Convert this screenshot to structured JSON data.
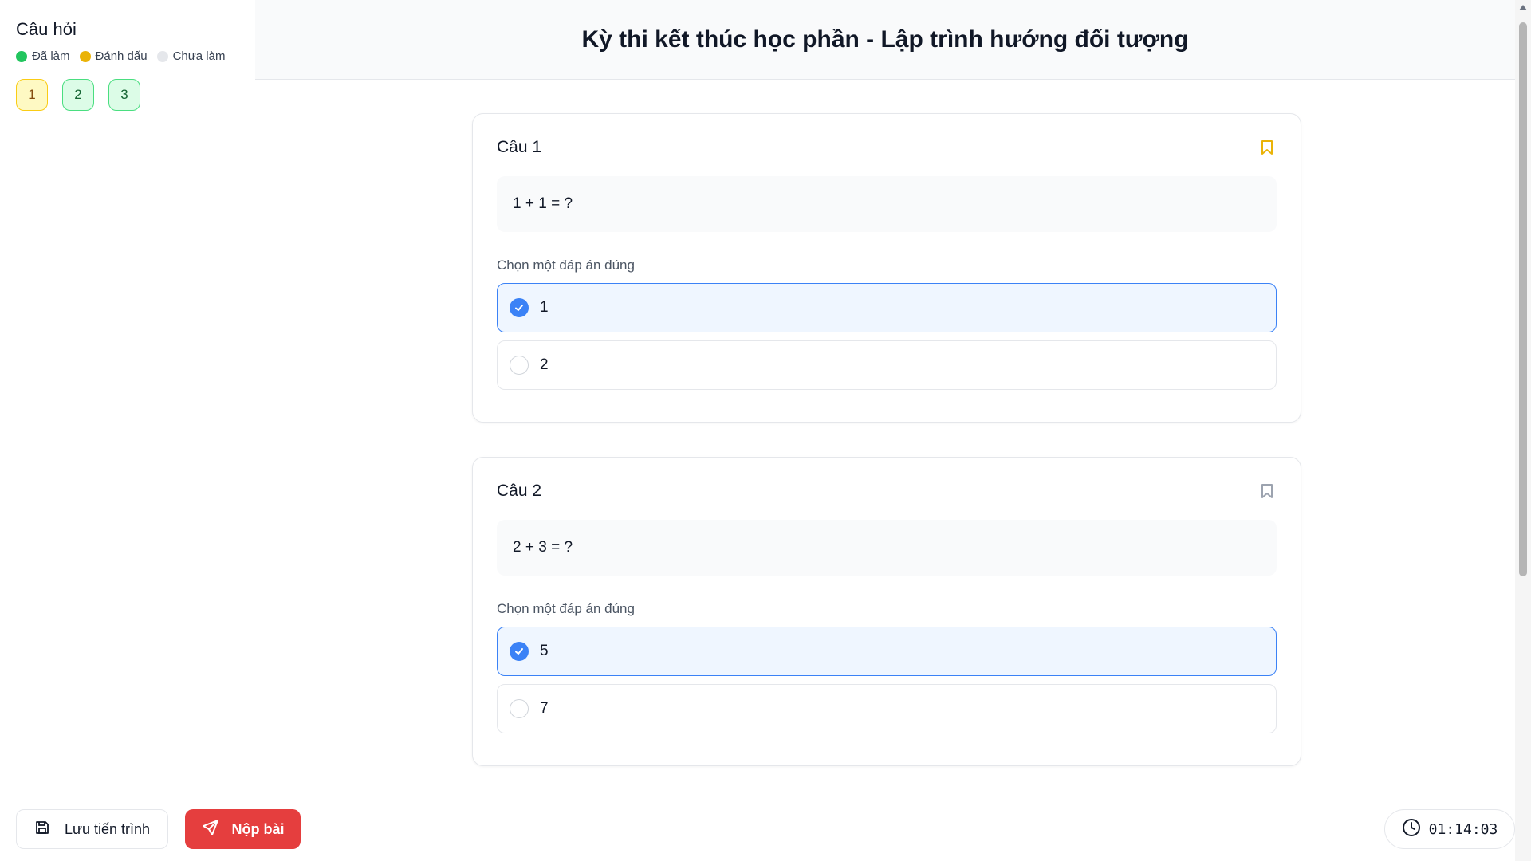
{
  "sidebar": {
    "title": "Câu hỏi",
    "legend": [
      {
        "label": "Đã làm",
        "color": "#22c55e"
      },
      {
        "label": "Đánh dấu",
        "color": "#eab308"
      },
      {
        "label": "Chưa làm",
        "color": "#e5e7eb"
      }
    ],
    "questions": [
      {
        "label": "1",
        "status": "marked"
      },
      {
        "label": "2",
        "status": "done"
      },
      {
        "label": "3",
        "status": "done"
      }
    ]
  },
  "header": {
    "title": "Kỳ thi kết thúc học phần - Lập trình hướng đối tượng"
  },
  "main": {
    "cards": [
      {
        "title": "Câu 1",
        "bookmarked": true,
        "question": "1 + 1 = ?",
        "instruction": "Chọn một đáp án đúng",
        "options": [
          {
            "label": "1",
            "selected": true
          },
          {
            "label": "2",
            "selected": false
          }
        ]
      },
      {
        "title": "Câu 2",
        "bookmarked": false,
        "question": "2 + 3 = ?",
        "instruction": "Chọn một đáp án đúng",
        "options": [
          {
            "label": "5",
            "selected": true
          },
          {
            "label": "7",
            "selected": false
          }
        ]
      }
    ]
  },
  "footer": {
    "save_label": "Lưu tiến trình",
    "submit_label": "Nộp bài",
    "timer": "01:14:03"
  },
  "colors": {
    "accent": "#3b82f6",
    "danger": "#e53e3e",
    "bookmark_active": "#eab308",
    "bookmark_inactive": "#9ca3af"
  }
}
